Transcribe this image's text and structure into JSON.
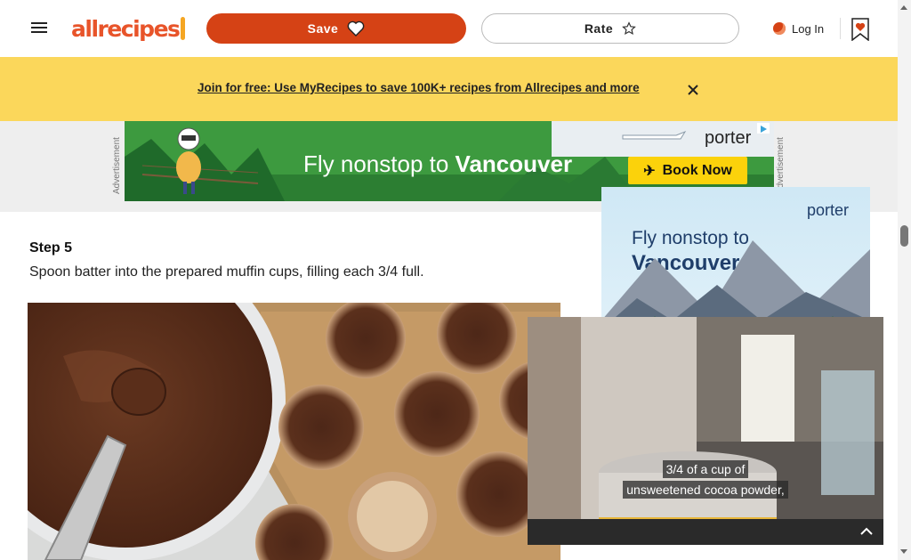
{
  "header": {
    "logo_text": "allrecipes",
    "save_label": "Save",
    "rate_label": "Rate",
    "login_label": "Log In",
    "brand_color": "#d54215"
  },
  "promo": {
    "text": "Join for free: Use MyRecipes to save 100K+ recipes from Allrecipes and more",
    "background": "#fbd75b"
  },
  "ad_top": {
    "label": "Advertisement",
    "headline_prefix": "Fly nonstop to ",
    "headline_city": "Vancouver",
    "brand": "porter",
    "cta": "Book Now"
  },
  "step": {
    "title": "Step 5",
    "text": "Spoon batter into the prepared muffin cups, filling each 3/4 full."
  },
  "ad_side": {
    "brand": "porter",
    "headline_line1": "Fly nonstop to",
    "headline_line2": "Vancouver"
  },
  "video": {
    "caption_line1": "3/4 of a cup of",
    "caption_line2": "unsweetened cocoa powder,"
  }
}
